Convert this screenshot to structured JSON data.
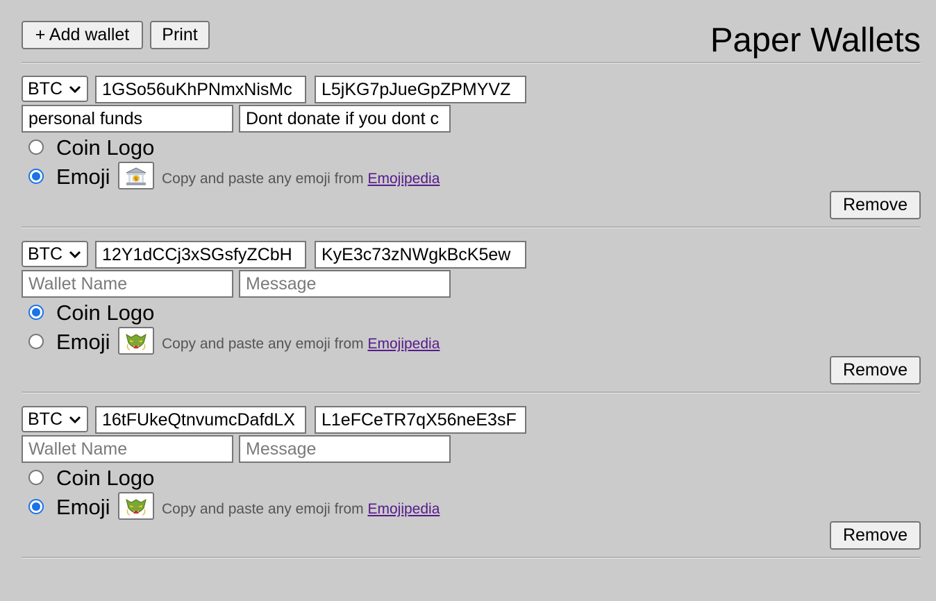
{
  "header": {
    "add_wallet_label": "+ Add wallet",
    "print_label": "Print",
    "title": "Paper Wallets"
  },
  "hint": {
    "text": "Copy and paste any emoji from ",
    "link_label": "Emojipedia"
  },
  "wallets": [
    {
      "coin": "BTC",
      "public_key": "1GSo56uKhPNmxNisMc",
      "private_key": "L5jKG7pJueGpZPMYVZ",
      "name_value": "personal funds",
      "name_placeholder": "Wallet Name",
      "message_value": "Dont donate if you dont c",
      "message_placeholder": "Message",
      "coin_logo_label": "Coin Logo",
      "emoji_label": "Emoji",
      "selected_option": "emoji",
      "emoji_icon": "bank-icon",
      "remove_label": "Remove"
    },
    {
      "coin": "BTC",
      "public_key": "12Y1dCCj3xSGsfyZCbH",
      "private_key": "KyE3c73zNWgkBcK5ew",
      "name_value": "",
      "name_placeholder": "Wallet Name",
      "message_value": "",
      "message_placeholder": "Message",
      "coin_logo_label": "Coin Logo",
      "emoji_label": "Emoji",
      "selected_option": "coin_logo",
      "emoji_icon": "goblin-mask-icon",
      "remove_label": "Remove"
    },
    {
      "coin": "BTC",
      "public_key": "16tFUkeQtnvumcDafdLX",
      "private_key": "L1eFCeTR7qX56neE3sF",
      "name_value": "",
      "name_placeholder": "Wallet Name",
      "message_value": "",
      "message_placeholder": "Message",
      "coin_logo_label": "Coin Logo",
      "emoji_label": "Emoji",
      "selected_option": "emoji",
      "emoji_icon": "goblin-mask-icon",
      "remove_label": "Remove"
    }
  ],
  "colors": {
    "background": "#cbcbcb",
    "radio_selected": "#1a73e8",
    "link_visited": "#551a8b"
  }
}
